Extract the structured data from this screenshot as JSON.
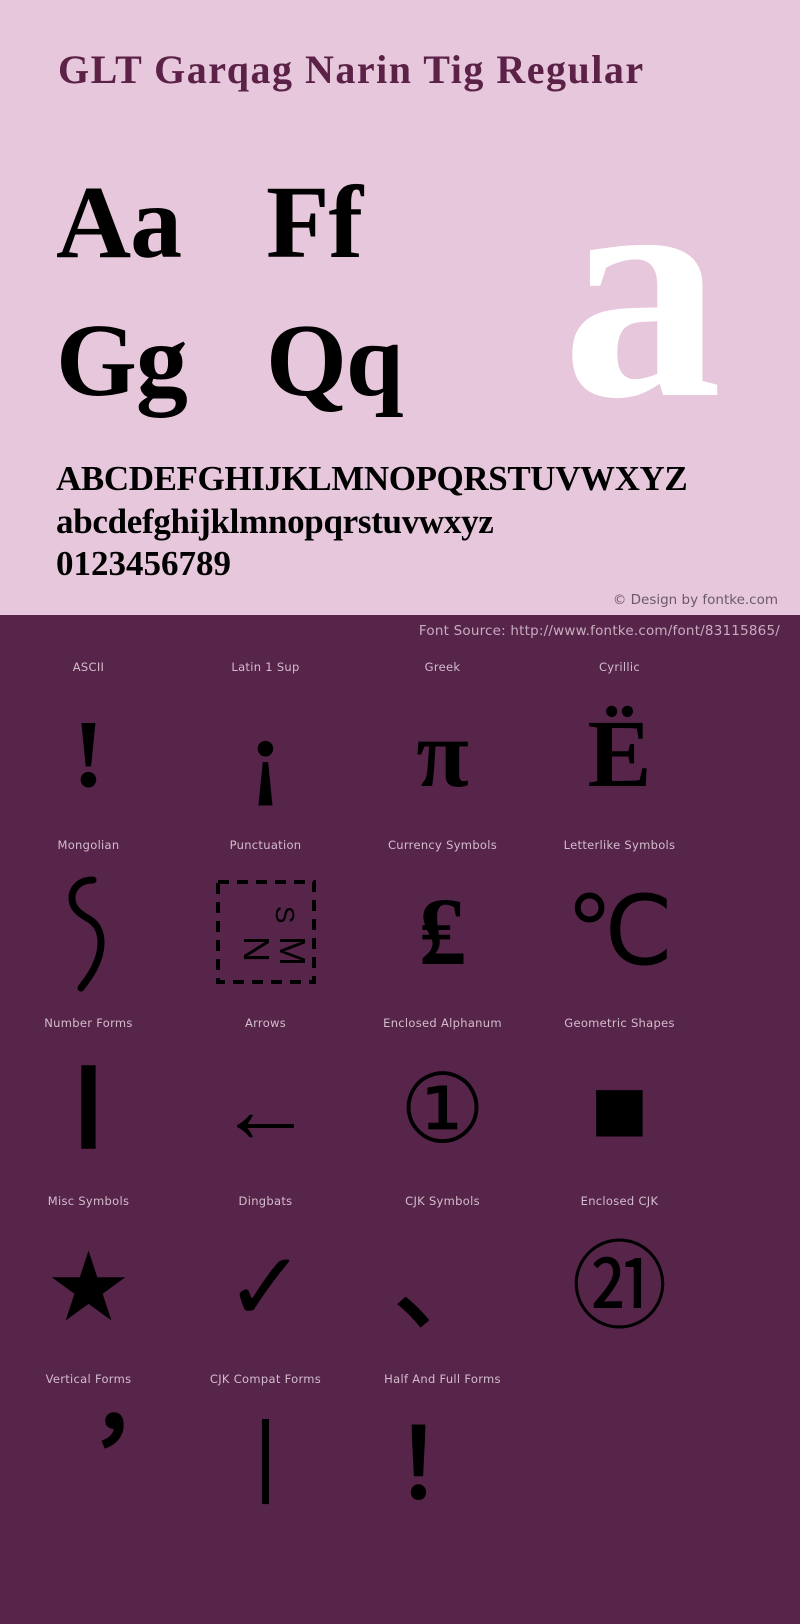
{
  "specimen": {
    "title": "GLT Garqag Narin Tig Regular",
    "letter_pairs": [
      [
        "Aa",
        "Ff"
      ],
      [
        "Gg",
        "Qq"
      ]
    ],
    "display_glyph": "a",
    "alphabet_upper": "ABCDEFGHIJKLMNOPQRSTUVWXYZ",
    "alphabet_lower": "abcdefghijklmnopqrstuvwxyz",
    "digits": "0123456789",
    "credit": "© Design by fontke.com"
  },
  "blocks_panel": {
    "source": "Font Source: http://www.fontke.com/font/83115865/",
    "rows": [
      [
        {
          "label": "ASCII",
          "glyph": "!"
        },
        {
          "label": "Latin 1 Sup",
          "glyph": "¡"
        },
        {
          "label": "Greek",
          "glyph": "π"
        },
        {
          "label": "Cyrillic",
          "glyph": "Ё"
        }
      ],
      [
        {
          "label": "Mongolian",
          "glyph": "ᠩ"
        },
        {
          "label": "Punctuation",
          "glyph": " "
        },
        {
          "label": "Currency Symbols",
          "glyph": "₤"
        },
        {
          "label": "Letterlike Symbols",
          "glyph": "℃"
        }
      ],
      [
        {
          "label": "Number Forms",
          "glyph": "Ⅰ"
        },
        {
          "label": "Arrows",
          "glyph": "←"
        },
        {
          "label": "Enclosed Alphanum",
          "glyph": "①"
        },
        {
          "label": "Geometric Shapes",
          "glyph": "■"
        }
      ],
      [
        {
          "label": "Misc Symbols",
          "glyph": "★"
        },
        {
          "label": "Dingbats",
          "glyph": "✓"
        },
        {
          "label": "CJK Symbols",
          "glyph": "、"
        },
        {
          "label": "Enclosed CJK",
          "glyph": "㉑"
        }
      ],
      [
        {
          "label": "Vertical Forms",
          "glyph": "︐"
        },
        {
          "label": "CJK Compat Forms",
          "glyph": "︱"
        },
        {
          "label": "Half And Full Forms",
          "glyph": "！"
        }
      ]
    ]
  },
  "colors": {
    "specimen_background": "#e7c7db",
    "blocks_background": "#57244a",
    "title_text": "#5b2147",
    "glyph_black": "#000000",
    "display_glyph_white": "#ffffff",
    "label_text": "#d3bdcd",
    "credit_text": "#6b5a66"
  }
}
